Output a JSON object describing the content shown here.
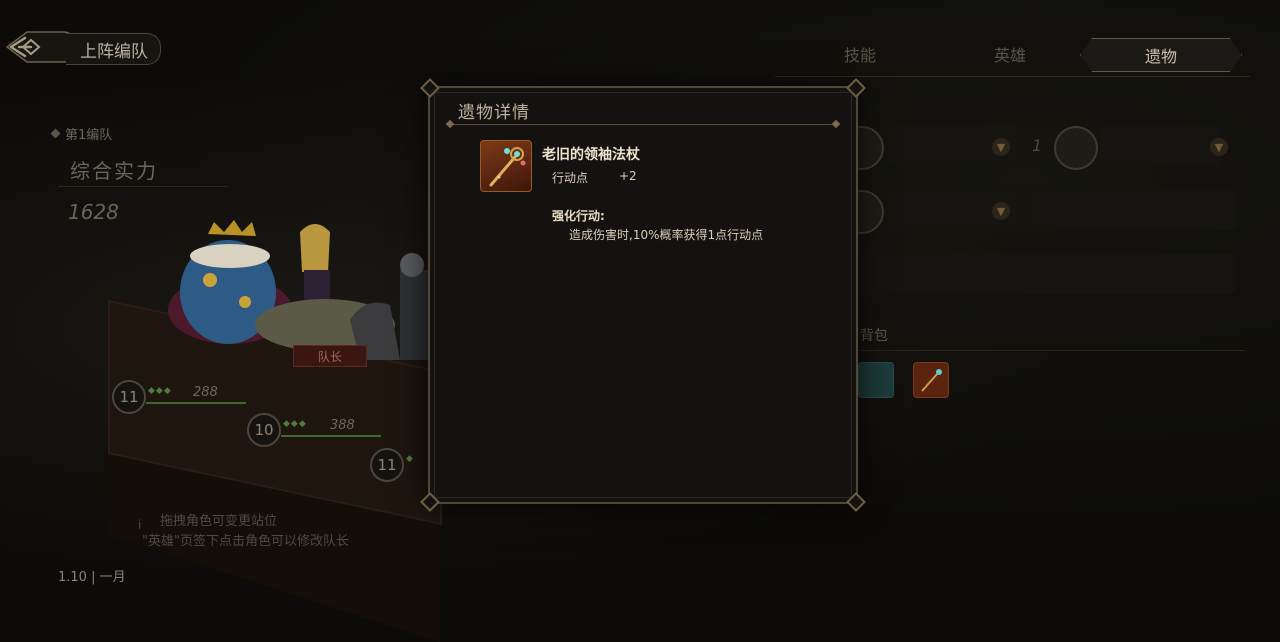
{
  "header": {
    "back_icon": "back-arrow-icon",
    "title": "上阵编队"
  },
  "team": {
    "label": "第1编队",
    "power_label": "综合实力",
    "power_value": "1628"
  },
  "roster": [
    {
      "level": "11",
      "hp": "288"
    },
    {
      "level": "10",
      "hp": "388"
    },
    {
      "level": "11",
      "hp": ""
    }
  ],
  "captain_tag": "队长",
  "tips": [
    "拖拽角色可变更站位",
    "\"英雄\"页签下点击角色可以修改队长"
  ],
  "version": "1.10 | 一月",
  "tabs": [
    {
      "label": "技能",
      "active": false
    },
    {
      "label": "英雄",
      "active": false
    },
    {
      "label": "遗物",
      "active": true
    }
  ],
  "bag_label": "背包",
  "slot_number": "1",
  "modal": {
    "title": "遗物详情",
    "item_name": "老旧的领袖法杖",
    "stat_label": "行动点",
    "stat_value": "+2",
    "effect_title": "强化行动:",
    "effect_desc": "造成伤害时,10%概率获得1点行动点"
  },
  "colors": {
    "background": "#0c0b09",
    "modal_border": "#4f4836",
    "accent_gold": "#7a6c4c",
    "item_orange": "#7a3a17"
  }
}
